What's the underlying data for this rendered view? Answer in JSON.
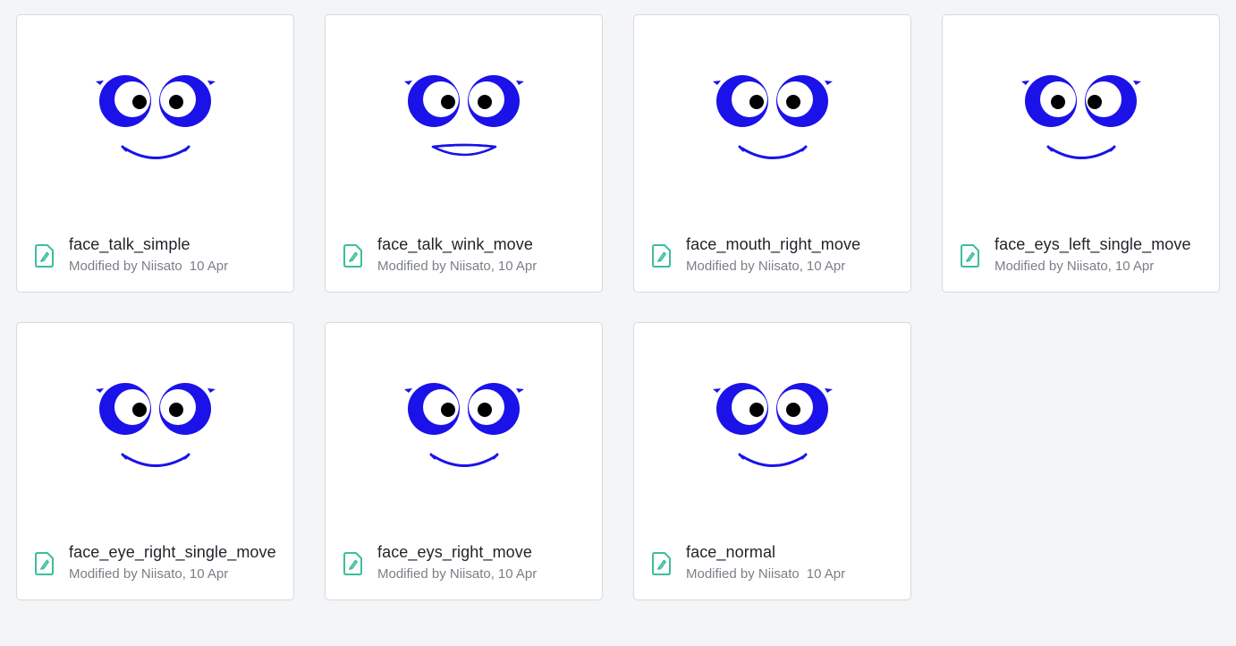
{
  "colors": {
    "face": "#1a12e8",
    "pupil": "#000000",
    "file_icon": "#3bbf9a"
  },
  "files": [
    {
      "name": "face_talk_simple",
      "modified_by": "Modified by Niisato",
      "date": "10 Apr",
      "truncated_by": true,
      "mouth": "smile",
      "pupils": "center"
    },
    {
      "name": "face_talk_wink_move",
      "modified_by": "Modified by Niisato,",
      "date": "10 Apr",
      "truncated_by": false,
      "mouth": "open",
      "pupils": "center"
    },
    {
      "name": "face_mouth_right_move",
      "modified_by": "Modified by Niisato,",
      "date": "10 Apr",
      "truncated_by": false,
      "mouth": "smile",
      "pupils": "center"
    },
    {
      "name": "face_eys_left_single_move",
      "modified_by": "Modified by Niisato,",
      "date": "10 Apr",
      "truncated_by": false,
      "mouth": "smile",
      "pupils": "left"
    },
    {
      "name": "face_eye_right_single_move",
      "modified_by": "Modified by Niisato,",
      "date": "10 Apr",
      "truncated_by": false,
      "mouth": "smile",
      "pupils": "center"
    },
    {
      "name": "face_eys_right_move",
      "modified_by": "Modified by Niisato,",
      "date": "10 Apr",
      "truncated_by": false,
      "mouth": "smile",
      "pupils": "center"
    },
    {
      "name": "face_normal",
      "modified_by": "Modified by Niisato",
      "date": "10 Apr",
      "truncated_by": true,
      "mouth": "smile",
      "pupils": "center"
    }
  ]
}
